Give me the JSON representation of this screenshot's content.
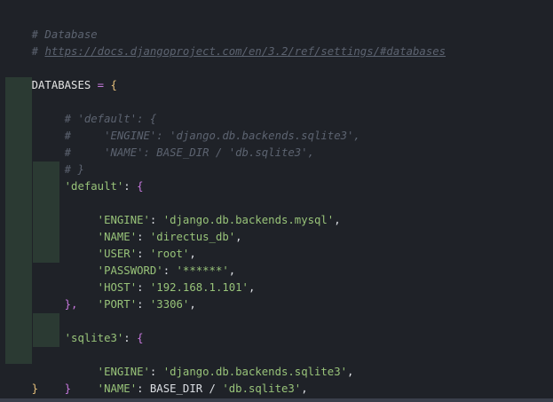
{
  "code": {
    "comment_database": "# Database",
    "comment_url_prefix": "# ",
    "comment_url": "https://docs.djangoproject.com/en/3.2/ref/settings/#databases",
    "databases_name": "DATABASES",
    "eq": " = ",
    "open_brace": "{",
    "close_brace": "}",
    "c_default_open": "# 'default': {",
    "c_engine": "#     'ENGINE': 'django.db.backends.sqlite3',",
    "c_name": "#     'NAME': BASE_DIR / 'db.sqlite3',",
    "c_close": "# }",
    "default_key": "'default'",
    "sqlite3_key": "'sqlite3'",
    "colon_open": ": {",
    "colon": ": ",
    "comma": ",",
    "close_comma": "},",
    "default_entries": [
      {
        "key": "'ENGINE'",
        "value": "'django.db.backends.mysql'"
      },
      {
        "key": "'NAME'",
        "value": "'directus_db'"
      },
      {
        "key": "'USER'",
        "value": "'root'"
      },
      {
        "key": "'PASSWORD'",
        "value": "'******'"
      },
      {
        "key": "'HOST'",
        "value": "'192.168.1.101'"
      },
      {
        "key": "'PORT'",
        "value": "'3306'"
      }
    ],
    "sqlite_engine_key": "'ENGINE'",
    "sqlite_engine_value": "'django.db.backends.sqlite3'",
    "sqlite_name_key": "'NAME'",
    "sqlite_name_base": "BASE_DIR",
    "sqlite_name_slash": " / ",
    "sqlite_name_value": "'db.sqlite3'"
  },
  "colors": {
    "background": "#1f2228",
    "comment": "#5c6370",
    "string": "#98c379",
    "operator": "#c678dd",
    "brace": "#e5c07b",
    "indent_guide": "#2b3a33"
  }
}
